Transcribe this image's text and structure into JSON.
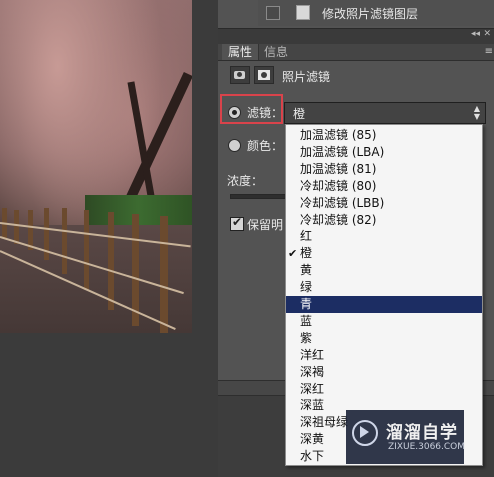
{
  "layers": {
    "layer_name": "修改照片滤镜图层"
  },
  "properties_panel": {
    "tabs": [
      {
        "label": "属性"
      },
      {
        "label": "信息"
      }
    ],
    "menu_icon": "≡",
    "adjustment_title": "照片滤镜",
    "filter_label": "滤镜：",
    "filter_value": "橙",
    "color_label": "颜色：",
    "density_label": "浓度：",
    "preserve_label": "保留明",
    "preserve_checked": true,
    "selected_radio": "filter"
  },
  "dropdown": {
    "options": [
      {
        "label": "加温滤镜 (85)"
      },
      {
        "label": "加温滤镜 (LBA)"
      },
      {
        "label": "加温滤镜 (81)"
      },
      {
        "label": "冷却滤镜 (80)"
      },
      {
        "label": "冷却滤镜 (LBB)"
      },
      {
        "label": "冷却滤镜 (82)"
      },
      {
        "label": "红"
      },
      {
        "label": "橙",
        "checked": true
      },
      {
        "label": "黄"
      },
      {
        "label": "绿"
      },
      {
        "label": "青",
        "highlighted": true
      },
      {
        "label": "蓝"
      },
      {
        "label": "紫"
      },
      {
        "label": "洋红"
      },
      {
        "label": "深褐"
      },
      {
        "label": "深红"
      },
      {
        "label": "深蓝"
      },
      {
        "label": "深祖母绿"
      },
      {
        "label": "深黄"
      },
      {
        "label": "水下"
      }
    ]
  },
  "watermark": {
    "title": "溜溜自学",
    "url": "ZIXUE.3066.COM"
  },
  "colors": {
    "highlight_box": "#d9434b",
    "selected_option": "#1c2d63"
  }
}
